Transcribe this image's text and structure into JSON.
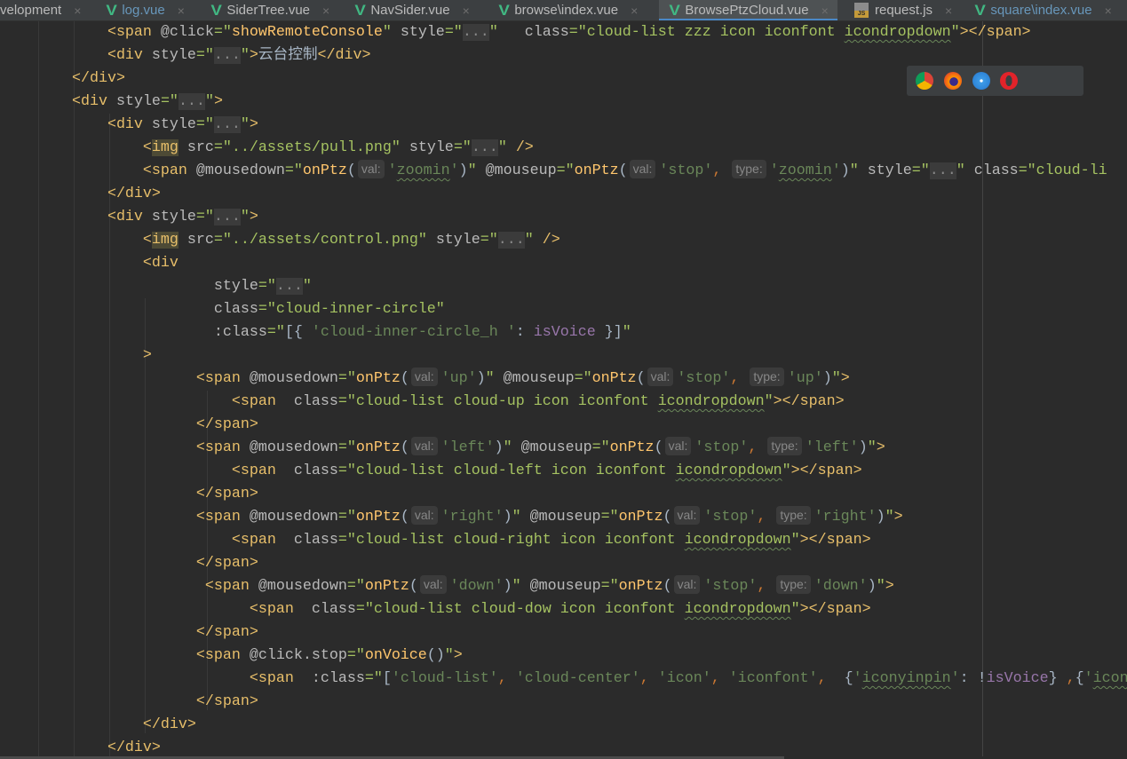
{
  "tabs": [
    {
      "label": "velopment",
      "icon": "none",
      "modified": false,
      "active": false
    },
    {
      "label": "log.vue",
      "icon": "vue-icon",
      "modified": true,
      "active": false
    },
    {
      "label": "SiderTree.vue",
      "icon": "vue-icon",
      "modified": false,
      "active": false
    },
    {
      "label": "NavSider.vue",
      "icon": "vue-icon",
      "modified": false,
      "active": false
    },
    {
      "label": "browse\\index.vue",
      "icon": "vue-icon",
      "modified": false,
      "active": false
    },
    {
      "label": "BrowsePtzCloud.vue",
      "icon": "vue-icon",
      "modified": false,
      "active": true
    },
    {
      "label": "request.js",
      "icon": "js-file-icon",
      "modified": false,
      "active": false
    },
    {
      "label": "square\\index.vue",
      "icon": "vue-icon",
      "modified": true,
      "active": false
    }
  ],
  "tab_close_glyph": "×",
  "vue_glyph": "V",
  "browsers": [
    "chrome-icon",
    "firefox-icon",
    "safari-icon",
    "opera-icon",
    "ie-icon",
    "edge-icon"
  ],
  "colors": {
    "tag": "#e8bf6a",
    "attribute": "#bababa",
    "string": "#a5c261",
    "function": "#ffc66d",
    "js_string": "#6a8759",
    "variable": "#9876aa",
    "accent": "#4a88c7",
    "background": "#2b2b2b"
  },
  "code_lines": [
    [
      [
        "t",
        "            <span "
      ],
      [
        "a",
        "@click"
      ],
      [
        "s",
        "=\""
      ],
      [
        "f",
        "showRemoteConsole"
      ],
      [
        "s",
        "\" "
      ],
      [
        "a",
        "style"
      ],
      [
        "s",
        "=\""
      ],
      [
        "e",
        "..."
      ],
      [
        "s",
        "\"   "
      ],
      [
        "a",
        "class"
      ],
      [
        "s",
        "=\"cloud-list zzz icon iconfont "
      ],
      [
        "su",
        "icondropdown"
      ],
      [
        "s",
        "\""
      ],
      [
        "t",
        "></span>"
      ]
    ],
    [
      [
        "t",
        "            <div "
      ],
      [
        "a",
        "style"
      ],
      [
        "s",
        "=\""
      ],
      [
        "e",
        "..."
      ],
      [
        "s",
        "\""
      ],
      [
        "t",
        ">"
      ],
      [
        "tx",
        "云台控制"
      ],
      [
        "t",
        "</div>"
      ]
    ],
    [
      [
        "t",
        "        </div>"
      ]
    ],
    [
      [
        "t",
        "        <div "
      ],
      [
        "a",
        "style"
      ],
      [
        "s",
        "=\""
      ],
      [
        "e",
        "..."
      ],
      [
        "s",
        "\""
      ],
      [
        "t",
        ">"
      ]
    ],
    [
      [
        "t",
        "            <div "
      ],
      [
        "a",
        "style"
      ],
      [
        "s",
        "=\""
      ],
      [
        "e",
        "..."
      ],
      [
        "s",
        "\""
      ],
      [
        "t",
        ">"
      ]
    ],
    [
      [
        "t",
        "                <"
      ],
      [
        "ti",
        "img"
      ],
      [
        "t",
        " "
      ],
      [
        "a",
        "src"
      ],
      [
        "s",
        "=\"../assets/pull.png\" "
      ],
      [
        "a",
        "style"
      ],
      [
        "s",
        "=\""
      ],
      [
        "e",
        "..."
      ],
      [
        "s",
        "\" "
      ],
      [
        "t",
        "/>"
      ]
    ],
    [
      [
        "t",
        "                <span "
      ],
      [
        "a",
        "@mousedown"
      ],
      [
        "s",
        "=\""
      ],
      [
        "f",
        "onPtz"
      ],
      [
        "p",
        "("
      ],
      [
        "h",
        "val:"
      ],
      [
        "q",
        "'"
      ],
      [
        "qu",
        "zoomin"
      ],
      [
        "q",
        "'"
      ],
      [
        "p",
        ")"
      ],
      [
        "s",
        "\" "
      ],
      [
        "a",
        "@mouseup"
      ],
      [
        "s",
        "=\""
      ],
      [
        "f",
        "onPtz"
      ],
      [
        "p",
        "("
      ],
      [
        "h",
        "val:"
      ],
      [
        "q",
        "'stop'"
      ],
      [
        "c",
        ", "
      ],
      [
        "h",
        "type:"
      ],
      [
        "q",
        "'"
      ],
      [
        "qu",
        "zoomin"
      ],
      [
        "q",
        "'"
      ],
      [
        "p",
        ")"
      ],
      [
        "s",
        "\" "
      ],
      [
        "a",
        "style"
      ],
      [
        "s",
        "=\""
      ],
      [
        "e",
        "..."
      ],
      [
        "s",
        "\" "
      ],
      [
        "a",
        "class"
      ],
      [
        "s",
        "=\"cloud-li"
      ]
    ],
    [
      [
        "t",
        "            </div>"
      ]
    ],
    [
      [
        "t",
        "            <div "
      ],
      [
        "a",
        "style"
      ],
      [
        "s",
        "=\""
      ],
      [
        "e",
        "..."
      ],
      [
        "s",
        "\""
      ],
      [
        "t",
        ">"
      ]
    ],
    [
      [
        "t",
        "                <"
      ],
      [
        "ti",
        "img"
      ],
      [
        "t",
        " "
      ],
      [
        "a",
        "src"
      ],
      [
        "s",
        "=\"../assets/control.png\" "
      ],
      [
        "a",
        "style"
      ],
      [
        "s",
        "=\""
      ],
      [
        "e",
        "..."
      ],
      [
        "s",
        "\" "
      ],
      [
        "t",
        "/>"
      ]
    ],
    [
      [
        "t",
        "                <div"
      ]
    ],
    [
      [
        "a",
        "                        style"
      ],
      [
        "s",
        "=\""
      ],
      [
        "e",
        "..."
      ],
      [
        "s",
        "\""
      ]
    ],
    [
      [
        "a",
        "                        class"
      ],
      [
        "s",
        "=\"cloud-inner-circle\""
      ]
    ],
    [
      [
        "a",
        "                        :class"
      ],
      [
        "s",
        "=\""
      ],
      [
        "p",
        "[{ "
      ],
      [
        "q",
        "'cloud-inner-circle_h '"
      ],
      [
        "p",
        ": "
      ],
      [
        "v",
        "isVoice"
      ],
      [
        "p",
        " }]"
      ],
      [
        "s",
        "\""
      ]
    ],
    [
      [
        "t",
        "                >"
      ]
    ],
    [
      [
        "t",
        "                      <span "
      ],
      [
        "a",
        "@mousedown"
      ],
      [
        "s",
        "=\""
      ],
      [
        "f",
        "onPtz"
      ],
      [
        "p",
        "("
      ],
      [
        "h",
        "val:"
      ],
      [
        "q",
        "'up'"
      ],
      [
        "p",
        ")"
      ],
      [
        "s",
        "\" "
      ],
      [
        "a",
        "@mouseup"
      ],
      [
        "s",
        "=\""
      ],
      [
        "f",
        "onPtz"
      ],
      [
        "p",
        "("
      ],
      [
        "h",
        "val:"
      ],
      [
        "q",
        "'stop'"
      ],
      [
        "c",
        ", "
      ],
      [
        "h",
        "type:"
      ],
      [
        "q",
        "'up'"
      ],
      [
        "p",
        ")"
      ],
      [
        "s",
        "\""
      ],
      [
        "t",
        ">"
      ]
    ],
    [
      [
        "t",
        "                          <span  "
      ],
      [
        "a",
        "class"
      ],
      [
        "s",
        "=\"cloud-list cloud-up icon iconfont "
      ],
      [
        "su",
        "icondropdown"
      ],
      [
        "s",
        "\""
      ],
      [
        "t",
        "></span>"
      ]
    ],
    [
      [
        "t",
        "                      </span>"
      ]
    ],
    [
      [
        "t",
        "                      <span "
      ],
      [
        "a",
        "@mousedown"
      ],
      [
        "s",
        "=\""
      ],
      [
        "f",
        "onPtz"
      ],
      [
        "p",
        "("
      ],
      [
        "h",
        "val:"
      ],
      [
        "q",
        "'left'"
      ],
      [
        "p",
        ")"
      ],
      [
        "s",
        "\" "
      ],
      [
        "a",
        "@mouseup"
      ],
      [
        "s",
        "=\""
      ],
      [
        "f",
        "onPtz"
      ],
      [
        "p",
        "("
      ],
      [
        "h",
        "val:"
      ],
      [
        "q",
        "'stop'"
      ],
      [
        "c",
        ", "
      ],
      [
        "h",
        "type:"
      ],
      [
        "q",
        "'left'"
      ],
      [
        "p",
        ")"
      ],
      [
        "s",
        "\""
      ],
      [
        "t",
        ">"
      ]
    ],
    [
      [
        "t",
        "                          <span  "
      ],
      [
        "a",
        "class"
      ],
      [
        "s",
        "=\"cloud-list cloud-left icon iconfont "
      ],
      [
        "su",
        "icondropdown"
      ],
      [
        "s",
        "\""
      ],
      [
        "t",
        "></span>"
      ]
    ],
    [
      [
        "t",
        "                      </span>"
      ]
    ],
    [
      [
        "t",
        "                      <span "
      ],
      [
        "a",
        "@mousedown"
      ],
      [
        "s",
        "=\""
      ],
      [
        "f",
        "onPtz"
      ],
      [
        "p",
        "("
      ],
      [
        "h",
        "val:"
      ],
      [
        "q",
        "'right'"
      ],
      [
        "p",
        ")"
      ],
      [
        "s",
        "\" "
      ],
      [
        "a",
        "@mouseup"
      ],
      [
        "s",
        "=\""
      ],
      [
        "f",
        "onPtz"
      ],
      [
        "p",
        "("
      ],
      [
        "h",
        "val:"
      ],
      [
        "q",
        "'stop'"
      ],
      [
        "c",
        ", "
      ],
      [
        "h",
        "type:"
      ],
      [
        "q",
        "'right'"
      ],
      [
        "p",
        ")"
      ],
      [
        "s",
        "\""
      ],
      [
        "t",
        ">"
      ]
    ],
    [
      [
        "t",
        "                          <span  "
      ],
      [
        "a",
        "class"
      ],
      [
        "s",
        "=\"cloud-list cloud-right icon iconfont "
      ],
      [
        "su",
        "icondropdown"
      ],
      [
        "s",
        "\""
      ],
      [
        "t",
        "></span>"
      ]
    ],
    [
      [
        "t",
        "                      </span>"
      ]
    ],
    [
      [
        "t",
        "                       <span "
      ],
      [
        "a",
        "@mousedown"
      ],
      [
        "s",
        "=\""
      ],
      [
        "f",
        "onPtz"
      ],
      [
        "p",
        "("
      ],
      [
        "h",
        "val:"
      ],
      [
        "q",
        "'down'"
      ],
      [
        "p",
        ")"
      ],
      [
        "s",
        "\" "
      ],
      [
        "a",
        "@mouseup"
      ],
      [
        "s",
        "=\""
      ],
      [
        "f",
        "onPtz"
      ],
      [
        "p",
        "("
      ],
      [
        "h",
        "val:"
      ],
      [
        "q",
        "'stop'"
      ],
      [
        "c",
        ", "
      ],
      [
        "h",
        "type:"
      ],
      [
        "q",
        "'down'"
      ],
      [
        "p",
        ")"
      ],
      [
        "s",
        "\""
      ],
      [
        "t",
        ">"
      ]
    ],
    [
      [
        "t",
        "                            <span  "
      ],
      [
        "a",
        "class"
      ],
      [
        "s",
        "=\"cloud-list cloud-dow icon iconfont "
      ],
      [
        "su",
        "icondropdown"
      ],
      [
        "s",
        "\""
      ],
      [
        "t",
        "></span>"
      ]
    ],
    [
      [
        "t",
        "                      </span>"
      ]
    ],
    [
      [
        "t",
        "                      <span "
      ],
      [
        "a",
        "@click.stop"
      ],
      [
        "s",
        "=\""
      ],
      [
        "f",
        "onVoice"
      ],
      [
        "p",
        "()"
      ],
      [
        "s",
        "\""
      ],
      [
        "t",
        ">"
      ]
    ],
    [
      [
        "t",
        "                            <span  "
      ],
      [
        "a",
        ":class"
      ],
      [
        "s",
        "=\""
      ],
      [
        "p",
        "["
      ],
      [
        "q",
        "'cloud-list'"
      ],
      [
        "c",
        ", "
      ],
      [
        "q",
        "'cloud-center'"
      ],
      [
        "c",
        ", "
      ],
      [
        "q",
        "'icon'"
      ],
      [
        "c",
        ", "
      ],
      [
        "q",
        "'iconfont'"
      ],
      [
        "c",
        ",  "
      ],
      [
        "p",
        "{"
      ],
      [
        "q",
        "'"
      ],
      [
        "qu",
        "iconyinpin"
      ],
      [
        "q",
        "'"
      ],
      [
        "p",
        ": !"
      ],
      [
        "v",
        "isVoice"
      ],
      [
        "p",
        "} "
      ],
      [
        "c",
        ","
      ],
      [
        "p",
        "{"
      ],
      [
        "q",
        "'"
      ],
      [
        "qu",
        "icon"
      ]
    ],
    [
      [
        "t",
        "                      </span>"
      ]
    ],
    [
      [
        "t",
        "                </div>"
      ]
    ],
    [
      [
        "t",
        "            </div>"
      ]
    ]
  ]
}
